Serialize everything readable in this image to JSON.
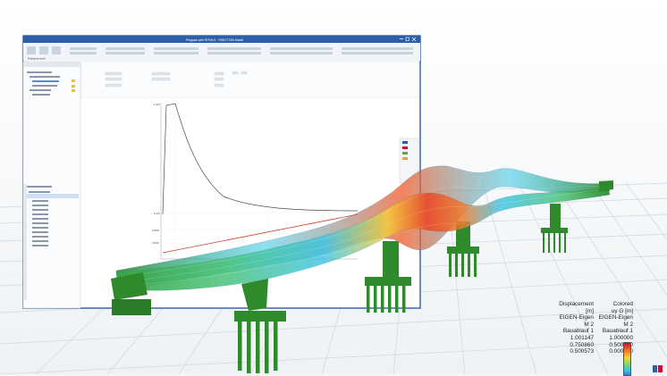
{
  "window": {
    "title": "Program with RFEM 6 · RSECTION Model",
    "ribbon_group": "Displacements"
  },
  "chart": {
    "tick_top": "1.3/5",
    "tick_mid": "0.1/0",
    "tick_a": "0.395",
    "tick_b": "0.000"
  },
  "legend_displacement": {
    "header": [
      "Displacement",
      "[m]",
      "EIGEN-Eigen",
      "M 2",
      "Bauablauf 1"
    ],
    "values": [
      "1.001147",
      "0.750860",
      "0.500573"
    ]
  },
  "legend_colored": {
    "header": [
      "Colored",
      "uy G [m]",
      "EIGEN-Eigen",
      "M 2",
      "Bauablauf 1"
    ],
    "values": [
      "1.000000",
      "0.500000",
      "0.000000"
    ]
  },
  "colors": {
    "pier": "#2f8a2c",
    "deck_low": "#39c3e3",
    "deck_high": "#e8492b",
    "grid": "#cfd6dc"
  }
}
